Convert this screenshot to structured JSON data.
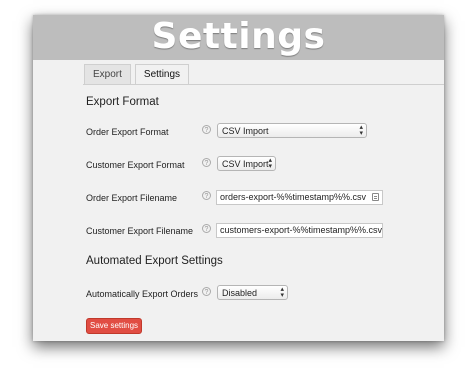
{
  "banner": {
    "title": "Settings"
  },
  "tabs": [
    {
      "label": "Export",
      "active": false
    },
    {
      "label": "Settings",
      "active": true
    }
  ],
  "sections": {
    "export_format": "Export Format",
    "automated": "Automated Export Settings"
  },
  "fields": {
    "order_export_format": {
      "label": "Order Export Format",
      "value": "CSV Import"
    },
    "customer_export_format": {
      "label": "Customer Export Format",
      "value": "CSV Import"
    },
    "order_export_filename": {
      "label": "Order Export Filename",
      "value": "orders-export-%%timestamp%%.csv"
    },
    "customer_export_filename": {
      "label": "Customer Export Filename",
      "value": "customers-export-%%timestamp%%.csv"
    },
    "auto_export_orders": {
      "label": "Automatically Export Orders",
      "value": "Disabled"
    }
  },
  "help_glyph": "?",
  "buttons": {
    "save": "Save settings"
  },
  "colors": {
    "banner": "#bdbdbd",
    "save_button": "#e14d43",
    "panel": "#f1f1f1"
  }
}
